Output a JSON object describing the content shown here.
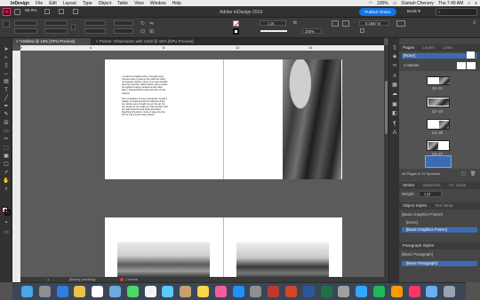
{
  "menubar": {
    "apple": "",
    "items": [
      "InDesign",
      "File",
      "Edit",
      "Layout",
      "Type",
      "Object",
      "Table",
      "View",
      "Window",
      "Help"
    ],
    "battery": "100%",
    "user": "Damah Chenery",
    "time": "Thu 7:49 AM"
  },
  "appbar": {
    "zoom": "59.9%",
    "title": "Adobe InDesign 2019",
    "publish_button": "Publish Online",
    "workspace": "Book"
  },
  "control": {
    "stroke_weight": "1 pt",
    "opacity": "100%",
    "ref_value": "0.1667 in"
  },
  "tabs": [
    {
      "label": "*Untitled @ 15% [GPU Preview]",
      "active": true
    },
    {
      "label": "Picture: Observation with Untitl @ 15% [GPU Preview]",
      "active": false
    }
  ],
  "ruler": {
    "ticks": [
      "0",
      "4",
      "8",
      "12",
      "16"
    ]
  },
  "spread1": {
    "text_p1": "\"I could not breathe when I thought every moment was my last on the earth for either an Antarctic warrior. None of us were familiar with the frost-bite. Which looks, and so when we sighted a large crevasse a few miles later, I dropped what I had and took out the camera.",
    "text_p2": "Over a distance of many hundreds of yards I raised my head and felt the stillness of the ice, where every breath hung in the air. No one spoke as we made our way forward, and the world beyond was white and silent. Reaching the camp, I knew it was only the first of many frozen days ahead.\""
  },
  "status": {
    "page": "1",
    "mode": "[Basic] (working)",
    "errors": "1 errors"
  },
  "panels": {
    "pages_tabs": [
      "Pages",
      "Layers",
      "Links"
    ],
    "none": "[None]",
    "master": "A-Master",
    "spreads": [
      "20–21",
      "22–23",
      "24–25",
      "26–27"
    ],
    "pages_footer": "44 Pages in 22 Spreads",
    "stroke_tabs": [
      "Stroke",
      "Swatches",
      "CC Librar"
    ],
    "weight_label": "Weight:",
    "weight_value": "1 pt",
    "object_styles_tabs": [
      "Object Styles",
      "Text Wrap"
    ],
    "object_style_current": "[Basic Graphics Frame]",
    "object_style_items": [
      "[None]",
      "[Basic Graphics Frame]"
    ],
    "paragraph_styles_title": "Paragraph Styles",
    "paragraph_style_current": "[Basic Paragraph]",
    "paragraph_style_items": [
      "[Basic Paragraph]"
    ]
  },
  "dock": {
    "icons": [
      "finder-icon",
      "launchpad-icon",
      "safari-icon",
      "chrome-icon",
      "calendar-icon",
      "mail-icon",
      "messages-icon",
      "photos-icon",
      "maps-icon",
      "contacts-icon",
      "notes-icon",
      "itunes-icon",
      "appstore-icon",
      "settings-icon",
      "acrobat-icon",
      "powerpoint-icon",
      "word-icon",
      "excel-icon",
      "files-icon",
      "photoshop-icon",
      "spotify-icon",
      "illustrator-icon",
      "indesign-icon",
      "folder-icon",
      "trash-icon"
    ],
    "colors": [
      "#4aa6e8",
      "#8e8e93",
      "#2f7de1",
      "#e8c34a",
      "#fff",
      "#6fa8dc",
      "#4cd964",
      "#f4f4f4",
      "#5ac8fa",
      "#c9a06b",
      "#f7d54c",
      "#f25c9a",
      "#1e90ff",
      "#8e8e93",
      "#c0392b",
      "#d24726",
      "#2b579a",
      "#1e7145",
      "#a0a0a0",
      "#31a8ff",
      "#1db954",
      "#ff9a00",
      "#ff3366",
      "#6ab0f3",
      "#9aa3ad"
    ]
  }
}
